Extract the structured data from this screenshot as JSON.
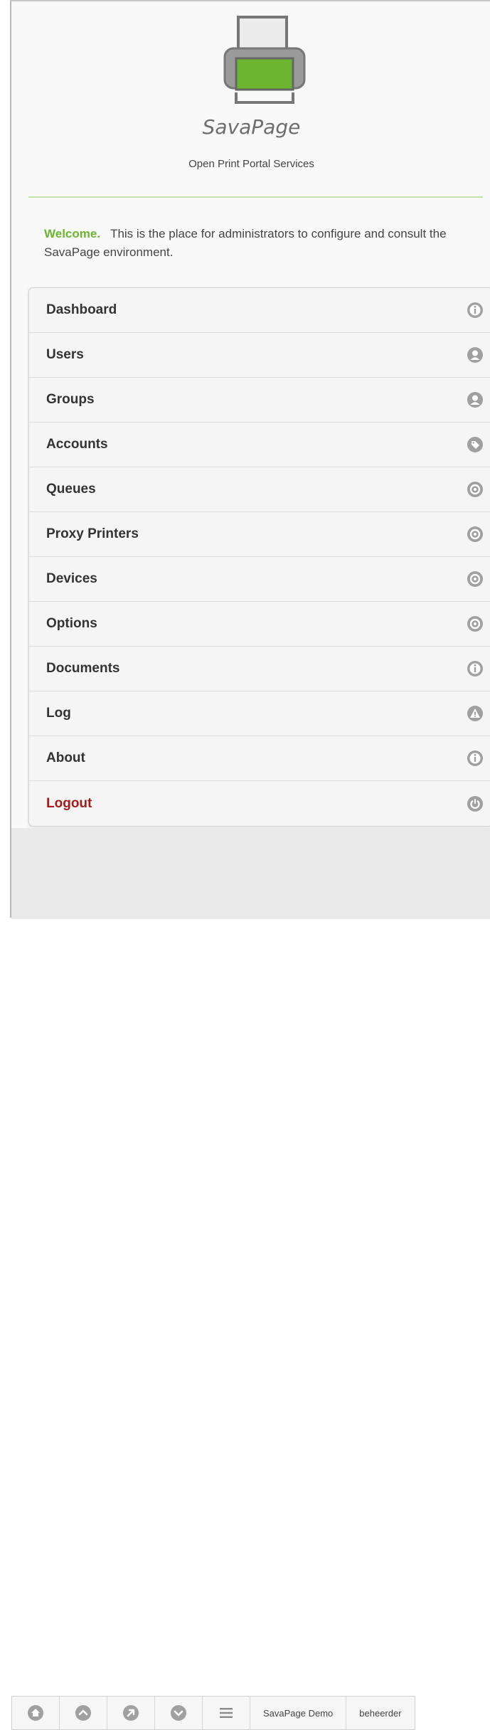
{
  "app": {
    "brand": "SavaPage",
    "subtitle": "Open Print Portal Services"
  },
  "welcome": {
    "highlight": "Welcome.",
    "text": "This is the place for administrators to configure and consult the SavaPage environment."
  },
  "menu": [
    {
      "label": "Dashboard",
      "icon": "info-icon"
    },
    {
      "label": "Users",
      "icon": "user-icon"
    },
    {
      "label": "Groups",
      "icon": "user-icon"
    },
    {
      "label": "Accounts",
      "icon": "tag-icon"
    },
    {
      "label": "Queues",
      "icon": "gear-icon"
    },
    {
      "label": "Proxy Printers",
      "icon": "gear-icon"
    },
    {
      "label": "Devices",
      "icon": "gear-icon"
    },
    {
      "label": "Options",
      "icon": "gear-icon"
    },
    {
      "label": "Documents",
      "icon": "info-icon"
    },
    {
      "label": "Log",
      "icon": "alert-icon"
    },
    {
      "label": "About",
      "icon": "info-icon"
    },
    {
      "label": "Logout",
      "icon": "power-icon"
    }
  ],
  "footer": {
    "buttons": [
      "home-icon",
      "arrow-up-icon",
      "arrow-up-right-icon",
      "arrow-down-icon",
      "menu-icon"
    ],
    "site_label": "SavaPage Demo",
    "user_label": "beheerder"
  },
  "colors": {
    "accent_green": "#6bb530",
    "logout_red": "#a31d1d",
    "icon_gray": "#a0a0a0"
  }
}
